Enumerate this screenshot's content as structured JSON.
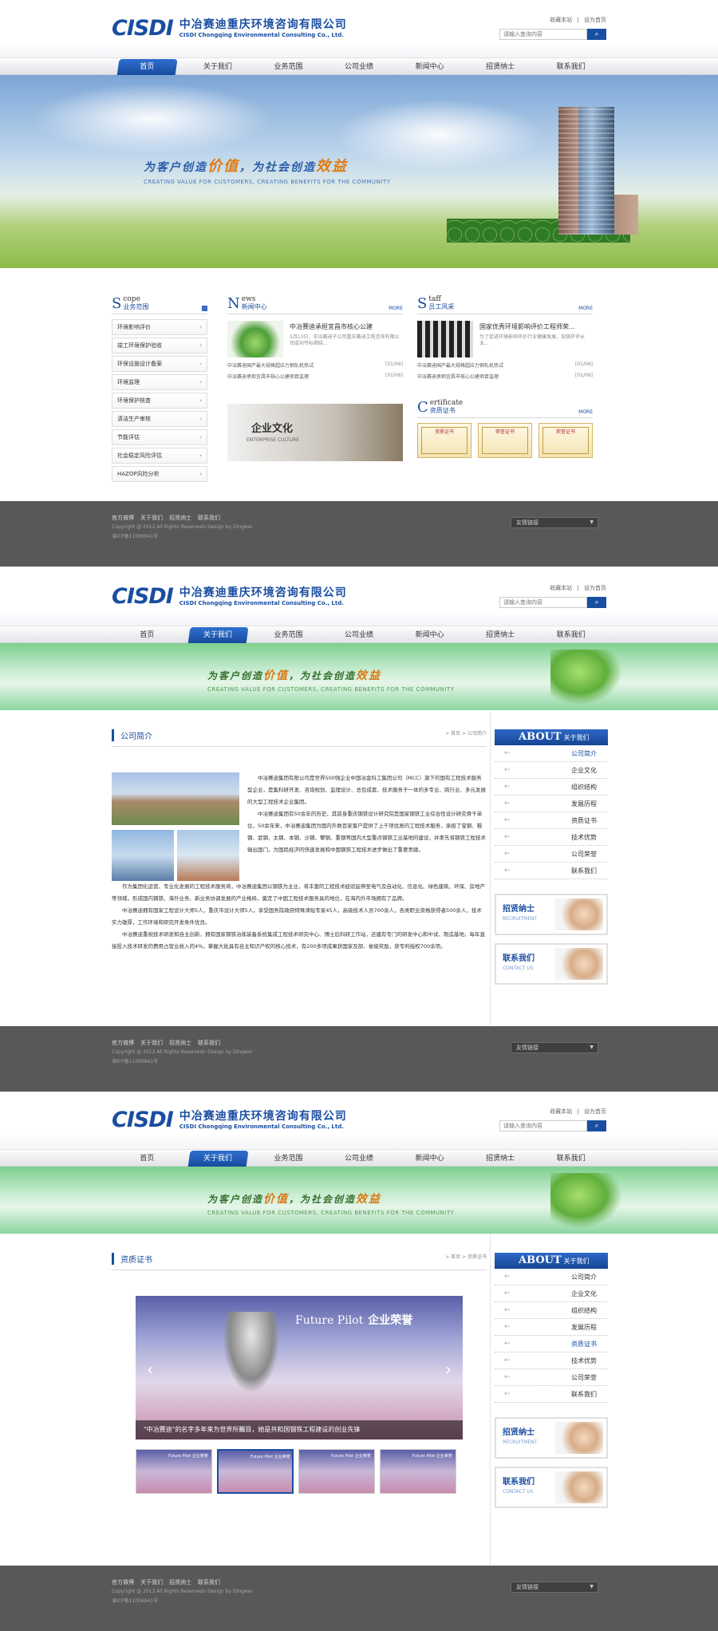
{
  "header": {
    "logo_mark": "CISDI",
    "logo_cn": "中冶赛迪重庆环境咨询有限公司",
    "logo_en": "CISDI Chongqing Environmental Consulting Co., Ltd.",
    "top_links": [
      "收藏本站",
      "|",
      "设为首页"
    ],
    "search_placeholder": "请输入查询内容",
    "search_icon": "search-icon"
  },
  "nav": [
    "首页",
    "关于我们",
    "业务范围",
    "公司业绩",
    "新闻中心",
    "招贤纳士",
    "联系我们"
  ],
  "banner_home": {
    "slogan_a": "为客户创造",
    "slogan_b": "价值",
    "slogan_c": "，为社会创造",
    "slogan_d": "效益",
    "slogan_en": "CREATING VALUE FOR CUSTOMERS, CREATING BENEFITS FOR THE COMMUNITY"
  },
  "banner_sub": {
    "slogan_a": "为客户创造",
    "slogan_b": "价值",
    "slogan_c": "，为社会创造",
    "slogan_d": "效益",
    "slogan_en": "CREATING VALUE FOR CUSTOMERS, CREATING BENEFITS FOR THE COMMUNITY"
  },
  "home": {
    "scope": {
      "big": "S",
      "en": "cope",
      "cn": "业务范围",
      "items": [
        "环境影响评价",
        "竣工环境保护验收",
        "环保设施设计备案",
        "环境监理",
        "环境保护核查",
        "清洁生产审核",
        "节能评估",
        "社会稳定风险评估",
        "HAZOP风险分析"
      ]
    },
    "news": {
      "big": "N",
      "en": "ews",
      "cn": "新闻中心",
      "more": "MORE",
      "headline": "中冶赛迪承担宜昌市核心公建",
      "desc": "5月13日，中冶赛迪子公司重庆赛迪工程咨询有限公司成功夺标揭晓...",
      "rows": [
        {
          "t": "中冶赛迪国产最大规格超应力钢轧机热试",
          "d": "[01/06]"
        },
        {
          "t": "中冶赛迪承担宜昌市核心公建项目监理",
          "d": "[01/06]"
        }
      ]
    },
    "staff": {
      "big": "S",
      "en": "taff",
      "cn": "员工风采",
      "more": "MORE",
      "headline": "国家优秀环境影响评价工程师荣...",
      "desc": "为了促进环境影响评价行业健康发展，加强环评从业...",
      "rows": [
        {
          "t": "中冶赛迪国产最大规格超应力钢轧机热试",
          "d": "[01/06]"
        },
        {
          "t": "中冶赛迪承担宜昌市核心公建项目监理",
          "d": "[01/06]"
        }
      ]
    },
    "culture": {
      "cn": "企业文化",
      "en": "ENTERPRISE CULTURE"
    },
    "cert": {
      "big": "C",
      "en": "ertificate",
      "cn": "资质证书",
      "more": "MORE",
      "items": [
        "资质证书",
        "荣誉证书",
        "荣誉证书"
      ]
    }
  },
  "footer": {
    "links": [
      "官方微博",
      "关于我们",
      "招贤纳士",
      "联系我们"
    ],
    "copyright": "Copyright @ 2012 All Rights Reservedn Design by Dingwei",
    "icp": "渝ICP备11006941号",
    "select": "友情链接"
  },
  "about": {
    "title": "公司简介",
    "crumb": "> 首页 > 公司简介",
    "side_en": "ABOUT",
    "side_cn": "关于我们",
    "side_items": [
      "公司简介",
      "企业文化",
      "组织结构",
      "发展历程",
      "资质证书",
      "技术优势",
      "公司荣誉",
      "联系我们"
    ],
    "recruit_cn": "招贤纳士",
    "recruit_en": "RECRUITMENT",
    "contact_cn": "联系我们",
    "contact_en": "CONTACT US",
    "p1": "中冶赛迪集团有限公司是世界500强企业中国冶金科工集团公司（MCC）旗下的国有工程技术服务型企业，是集科研开发、咨询规划、监理设计、总包成套、技术服务于一体的多专业、跨行业、多元发展的大型工程技术企业集团。",
    "p2": "中冶赛迪集团有50余年的历史，其前身重庆钢铁设计研究院是国家钢铁工业综合性设计研究骨干单位，50余年来，中冶赛迪集团为国内外数百家客户提供了上千项优质的工程技术服务，承担了宝钢、鞍钢、武钢、太钢、本钢、沙钢、攀钢、重钢等国内大型重点钢铁工业基地的建设，并率先将钢铁工程技术输出国门，为国民经济的快速发展和中国钢铁工程技术进步做出了重要贡献。",
    "p3": "作为集团化运营、专业化发展的工程技术服务商，中冶赛迪集团以钢铁为主业，将丰富的工程技术经验延伸至电气及自动化、信息化、绿色建筑、环保、房地产等领域，形成国内钢铁、海外业务、新业务协调发展的产业格局，奠定了中国工程技术服务具的地位，在海内外市场拥有了品牌。",
    "p4": "中冶赛迪拥有国家工程设计大师5人，重庆市设计大师5人，享受国务院政府特殊津贴专家45人，高级技术人员700余人，各类职业资格获得者500余人，技术实力雄厚，工作环境和研究开发条件优良。",
    "p5": "中冶赛迪重视技术研发和自主创新，拥有国家钢铁冶炼装备系统集成工程技术研究中心、博士后科研工作站，还建有专门的研发中心和中试、制造基地，每年直接投入技术研发的费用占营业收入的4%，掌握大批具有自主知识产权的核心技术，有200多项成果获国家及部、省级奖励，获专利授权700余项。"
  },
  "cert_page": {
    "title": "资质证书",
    "crumb": "> 首页 > 资质证书",
    "slider_en": "Future Pilot",
    "slider_cn": "企业荣誉",
    "caption": "\"中冶赛迪\"的名字多年来为世界所瞩目，她是共和国钢铁工程建设的创业先锋",
    "thumb_label": "Future Pilot 企业荣誉"
  }
}
